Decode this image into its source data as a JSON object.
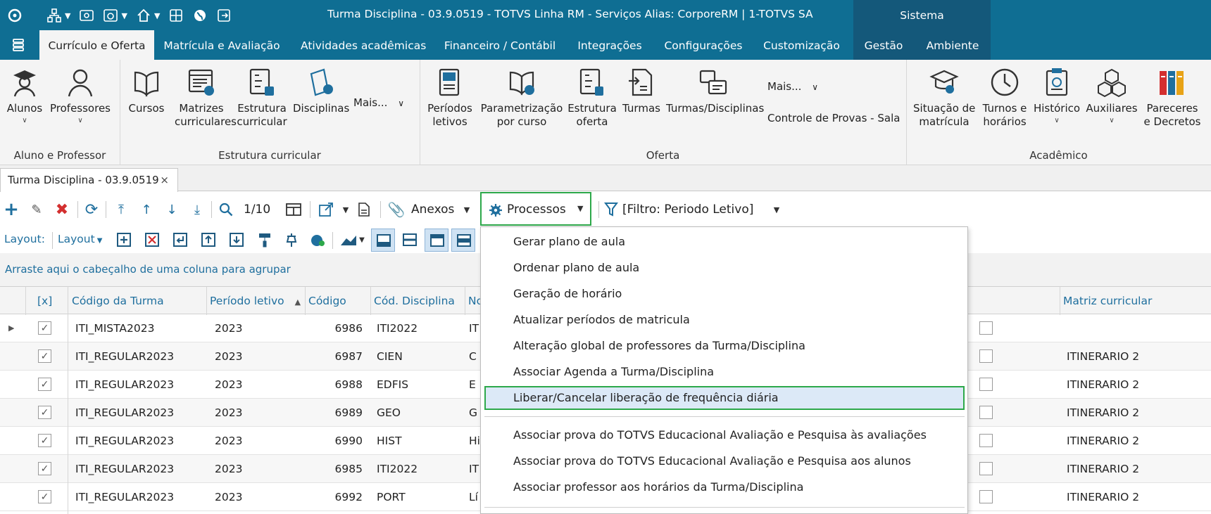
{
  "titlebar": {
    "title": "Turma Disciplina - 03.9.0519 - TOTVS Linha RM - Serviços  Alias: CorporeRM | 1-TOTVS SA",
    "sistema_label": "Sistema"
  },
  "menu_tabs": {
    "curriculo": "Currículo e Oferta",
    "matricula": "Matrícula e Avaliação",
    "atividades": "Atividades acadêmicas",
    "financeiro": "Financeiro / Contábil",
    "integracoes": "Integrações",
    "configuracoes": "Configurações",
    "customizacao": "Customização",
    "gestao": "Gestão",
    "ambiente": "Ambiente"
  },
  "ribbon": {
    "alunos": "Alunos",
    "professores": "Professores",
    "cursos": "Cursos",
    "matrizes_1": "Matrizes",
    "matrizes_2": "curriculares",
    "estrutura_1": "Estrutura",
    "estrutura_2": "curricular",
    "disciplinas": "Disciplinas",
    "mais1": "Mais...",
    "periodos_1": "Períodos",
    "periodos_2": "letivos",
    "param_1": "Parametrização",
    "param_2": "por curso",
    "estoferta_1": "Estrutura",
    "estoferta_2": "oferta",
    "turmas": "Turmas",
    "turmas_disc": "Turmas/Disciplinas",
    "mais2": "Mais...",
    "controle_provas": "Controle de Provas - Sala",
    "situacao_1": "Situação de",
    "situacao_2": "matrícula",
    "turnos_1": "Turnos e",
    "turnos_2": "horários",
    "historico": "Histórico",
    "auxiliares": "Auxiliares",
    "pareceres_1": "Pareceres",
    "pareceres_2": "e Decretos",
    "group_aluno": "Aluno e Professor",
    "group_estrutura": "Estrutura curricular",
    "group_oferta": "Oferta",
    "group_academico": "Acadêmico"
  },
  "doc_tab": {
    "label": "Turma Disciplina - 03.9.0519",
    "close": "×"
  },
  "toolbar": {
    "page": "1/10",
    "anexos": "Anexos",
    "processos": "Processos",
    "filtro": "[Filtro: Periodo Letivo]",
    "layout_label": "Layout:",
    "layout_btn": "Layout"
  },
  "group_hint": "Arraste aqui o cabeçalho de uma coluna para agrupar",
  "grid": {
    "headers": {
      "x": "[x]",
      "codigo_turma": "Código da Turma",
      "periodo": "Período letivo",
      "codigo": "Código",
      "cod_disciplina": "Cód. Disciplina",
      "nome": "No",
      "matriz": "Matriz curricular"
    },
    "rows": [
      {
        "turma": "ITI_MISTA2023",
        "periodo": "2023",
        "codigo": "6986",
        "disc": "ITI2022",
        "nome": "IT",
        "matriz": ""
      },
      {
        "turma": "ITI_REGULAR2023",
        "periodo": "2023",
        "codigo": "6987",
        "disc": "CIEN",
        "nome": "C",
        "matriz": "ITINERARIO 2"
      },
      {
        "turma": "ITI_REGULAR2023",
        "periodo": "2023",
        "codigo": "6988",
        "disc": "EDFIS",
        "nome": "E",
        "matriz": "ITINERARIO 2"
      },
      {
        "turma": "ITI_REGULAR2023",
        "periodo": "2023",
        "codigo": "6989",
        "disc": "GEO",
        "nome": "G",
        "matriz": "ITINERARIO 2"
      },
      {
        "turma": "ITI_REGULAR2023",
        "periodo": "2023",
        "codigo": "6990",
        "disc": "HIST",
        "nome": "Hi",
        "matriz": "ITINERARIO 2"
      },
      {
        "turma": "ITI_REGULAR2023",
        "periodo": "2023",
        "codigo": "6985",
        "disc": "ITI2022",
        "nome": "IT",
        "matriz": "ITINERARIO 2"
      },
      {
        "turma": "ITI_REGULAR2023",
        "periodo": "2023",
        "codigo": "6992",
        "disc": "PORT",
        "nome": "Lí",
        "matriz": "ITINERARIO 2"
      }
    ]
  },
  "dropdown": {
    "items": [
      "Gerar plano de aula",
      "Ordenar plano de aula",
      "Geração de horário",
      "Atualizar períodos de matricula",
      "Alteração global de professores da Turma/Disciplina",
      "Associar Agenda a Turma/Disciplina",
      "Liberar/Cancelar liberação de frequência diária",
      "Associar prova do TOTVS Educacional Avaliação e Pesquisa às avaliações",
      "Associar prova do TOTVS Educacional Avaliação e Pesquisa aos alunos",
      "Associar professor aos horários da Turma/Disciplina"
    ]
  },
  "colors": {
    "brand_blue": "#0f6e93",
    "accent_dark": "#14587a",
    "highlight_green": "#2da84a",
    "add_green": "#1f6f9e",
    "delete_red": "#d32f2f"
  }
}
